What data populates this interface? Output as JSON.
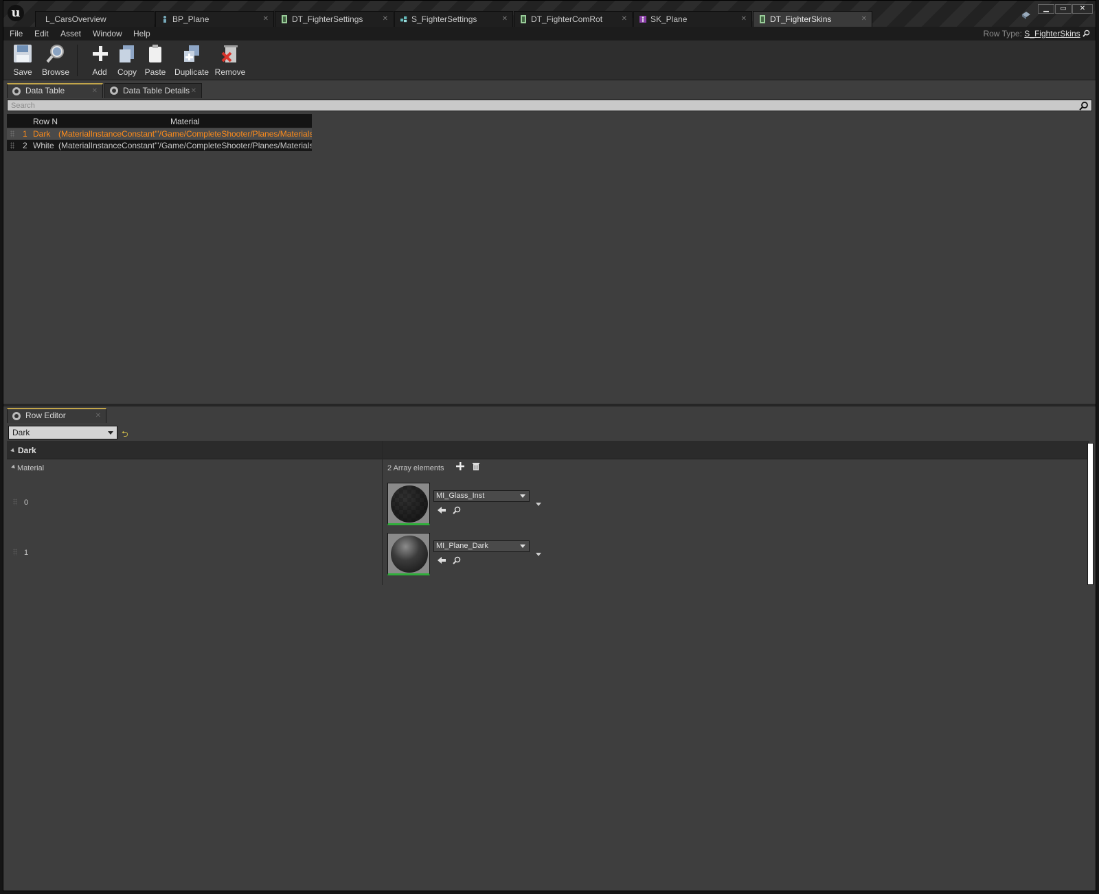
{
  "tabs": [
    {
      "label": "L_CarsOverview",
      "icon": "level-icon"
    },
    {
      "label": "BP_Plane",
      "icon": "blueprint-icon"
    },
    {
      "label": "DT_FighterSettings",
      "icon": "data-table-icon"
    },
    {
      "label": "S_FighterSettings",
      "icon": "struct-icon"
    },
    {
      "label": "DT_FighterComRot",
      "icon": "data-table-icon"
    },
    {
      "label": "SK_Plane",
      "icon": "skeletal-mesh-icon"
    },
    {
      "label": "DT_FighterSkins",
      "icon": "data-table-icon"
    }
  ],
  "window_controls": {
    "minimize": "▁",
    "maximize": "▭",
    "close": "✕"
  },
  "menu": [
    "File",
    "Edit",
    "Asset",
    "Window",
    "Help"
  ],
  "row_type": {
    "label": "Row Type:",
    "value": "S_FighterSkins"
  },
  "toolbar": {
    "save": "Save",
    "browse": "Browse",
    "add": "Add",
    "copy": "Copy",
    "paste": "Paste",
    "duplicate": "Duplicate",
    "remove": "Remove"
  },
  "panel_tabs": {
    "data_table": "Data Table",
    "data_table_details": "Data Table Details",
    "row_editor": "Row Editor"
  },
  "search": {
    "placeholder": "Search"
  },
  "table": {
    "columns": [
      "Row N",
      "Material"
    ],
    "rows": [
      {
        "index": "1",
        "name": "Dark",
        "material": "(MaterialInstanceConstant'\"/Game/CompleteShooter/Planes/Materials/F"
      },
      {
        "index": "2",
        "name": "White",
        "material": "(MaterialInstanceConstant'\"/Game/CompleteShooter/Planes/Materials/F"
      }
    ]
  },
  "row_editor": {
    "selected_row": "Dark",
    "category": "Dark",
    "property": "Material",
    "array_count": "2 Array elements",
    "elements": [
      {
        "index": "0",
        "asset": "MI_Glass_Inst"
      },
      {
        "index": "1",
        "asset": "MI_Plane_Dark"
      }
    ]
  },
  "colors": {
    "accent": "#c2a54a",
    "selected_row_text": "#ff8c1a",
    "thumbnail_valid": "#2fae3a"
  }
}
